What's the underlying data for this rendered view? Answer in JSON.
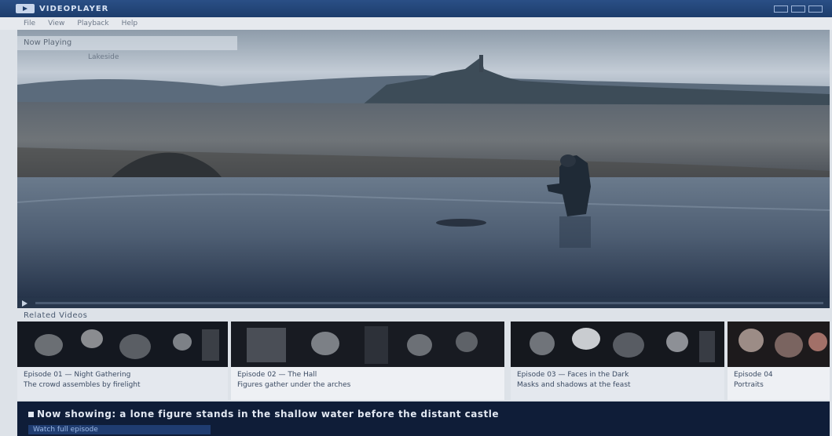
{
  "window": {
    "title": "VIDEOPLAYER",
    "controls": [
      "minimize",
      "maximize",
      "close"
    ]
  },
  "menubar": {
    "items": [
      "File",
      "View",
      "Playback",
      "Help"
    ]
  },
  "player": {
    "overlay_title": "Now Playing",
    "overlay_subtitle": "Lakeside",
    "progress": 0
  },
  "related": {
    "heading": "Related Videos",
    "thumbnails": [
      {
        "caption_line1": "Episode 01 — Night Gathering",
        "caption_line2": "The crowd assembles by firelight"
      },
      {
        "caption_line1": "Episode 02 — The Hall",
        "caption_line2": "Figures gather under the arches"
      },
      {
        "caption_line1": "Episode 03 — Faces in the Dark",
        "caption_line2": "Masks and shadows at the feast"
      },
      {
        "caption_line1": "Episode 04",
        "caption_line2": "Portraits"
      }
    ]
  },
  "banner": {
    "headline": "Now showing: a lone figure stands in the shallow water before the distant castle",
    "link": "Watch full episode"
  },
  "colors": {
    "titlebar": "#1d3d6c",
    "banner": "#0f1d38",
    "accent": "#9bb8e6"
  }
}
